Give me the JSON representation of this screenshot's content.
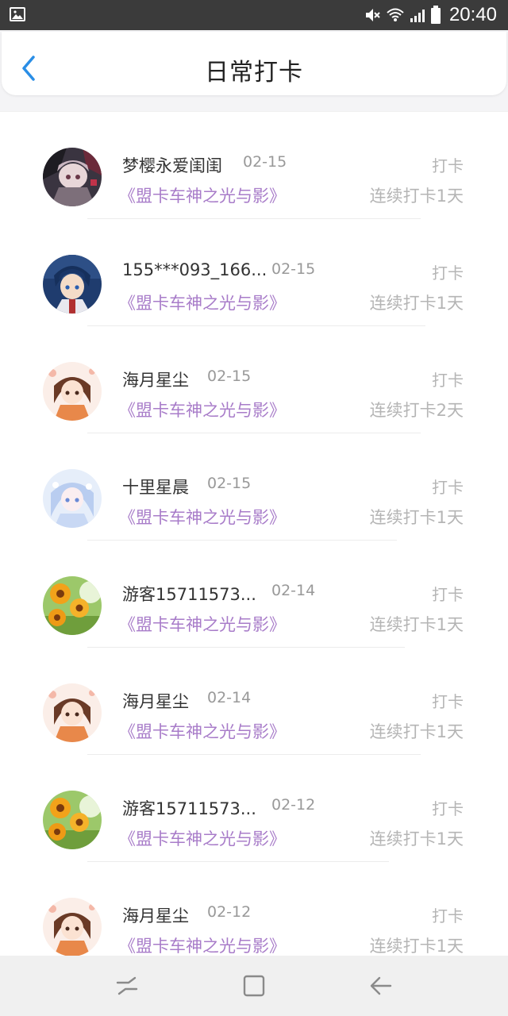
{
  "status_bar": {
    "time": "20:40",
    "icons": [
      "gallery-icon",
      "mute-icon",
      "wifi-icon",
      "signal-icon",
      "battery-icon"
    ]
  },
  "header": {
    "title": "日常打卡",
    "back_icon": "chevron-left-icon",
    "accent": "#2a8ee6"
  },
  "colors": {
    "game_text": "#a87cc9",
    "muted_text": "#b5b5b5"
  },
  "checkins": [
    {
      "user": "梦樱永爱闺闺",
      "date": "02-15",
      "action": "打卡",
      "game": "《盟卡车神之光与影》",
      "streak": "连续打卡1天"
    },
    {
      "user": "155***093_166...",
      "date": "02-15",
      "action": "打卡",
      "game": "《盟卡车神之光与影》",
      "streak": "连续打卡1天"
    },
    {
      "user": "海月星尘",
      "date": "02-15",
      "action": "打卡",
      "game": "《盟卡车神之光与影》",
      "streak": "连续打卡2天"
    },
    {
      "user": "十里星晨",
      "date": "02-15",
      "action": "打卡",
      "game": "《盟卡车神之光与影》",
      "streak": "连续打卡1天"
    },
    {
      "user": "游客15711573...",
      "date": "02-14",
      "action": "打卡",
      "game": "《盟卡车神之光与影》",
      "streak": "连续打卡1天"
    },
    {
      "user": "海月星尘",
      "date": "02-14",
      "action": "打卡",
      "game": "《盟卡车神之光与影》",
      "streak": "连续打卡1天"
    },
    {
      "user": "游客15711573...",
      "date": "02-12",
      "action": "打卡",
      "game": "《盟卡车神之光与影》",
      "streak": "连续打卡1天"
    },
    {
      "user": "海月星尘",
      "date": "02-12",
      "action": "打卡",
      "game": "《盟卡车神之光与影》",
      "streak": "连续打卡1天"
    }
  ],
  "nav_bar": {
    "buttons": [
      "recent-apps-icon",
      "home-icon",
      "back-arrow-icon"
    ]
  }
}
